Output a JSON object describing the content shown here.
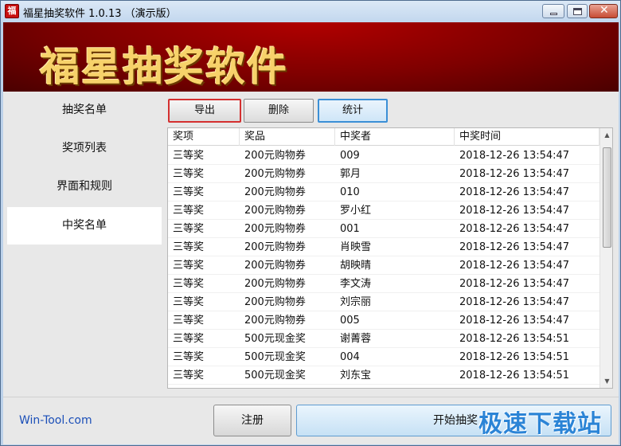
{
  "window": {
    "title": "福星抽奖软件 1.0.13 （演示版）",
    "app_icon_char": "福"
  },
  "banner": {
    "title": "福星抽奖软件"
  },
  "sidebar": {
    "items": [
      {
        "label": "抽奖名单",
        "active": false
      },
      {
        "label": "奖项列表",
        "active": false
      },
      {
        "label": "界面和规则",
        "active": false
      },
      {
        "label": "中奖名单",
        "active": true
      }
    ]
  },
  "toolbar": {
    "export_label": "导出",
    "delete_label": "删除",
    "stats_label": "统计"
  },
  "table": {
    "columns": [
      "奖项",
      "奖品",
      "中奖者",
      "中奖时间"
    ],
    "rows": [
      [
        "三等奖",
        "200元购物券",
        "009",
        "2018-12-26 13:54:47"
      ],
      [
        "三等奖",
        "200元购物券",
        "郭月",
        "2018-12-26 13:54:47"
      ],
      [
        "三等奖",
        "200元购物券",
        "010",
        "2018-12-26 13:54:47"
      ],
      [
        "三等奖",
        "200元购物券",
        "罗小红",
        "2018-12-26 13:54:47"
      ],
      [
        "三等奖",
        "200元购物券",
        "001",
        "2018-12-26 13:54:47"
      ],
      [
        "三等奖",
        "200元购物券",
        "肖映雪",
        "2018-12-26 13:54:47"
      ],
      [
        "三等奖",
        "200元购物券",
        "胡映晴",
        "2018-12-26 13:54:47"
      ],
      [
        "三等奖",
        "200元购物券",
        "李文涛",
        "2018-12-26 13:54:47"
      ],
      [
        "三等奖",
        "200元购物券",
        "刘宗丽",
        "2018-12-26 13:54:47"
      ],
      [
        "三等奖",
        "200元购物券",
        "005",
        "2018-12-26 13:54:47"
      ],
      [
        "三等奖",
        "500元现金奖",
        "谢菁蓉",
        "2018-12-26 13:54:51"
      ],
      [
        "三等奖",
        "500元现金奖",
        "004",
        "2018-12-26 13:54:51"
      ],
      [
        "三等奖",
        "500元现金奖",
        "刘东宝",
        "2018-12-26 13:54:51"
      ]
    ]
  },
  "footer": {
    "link_text": "Win-Tool.com",
    "register_label": "注册",
    "start_label": "开始抽奖"
  },
  "watermark": {
    "text": "极速下载站"
  },
  "colors": {
    "banner_red": "#7e0000",
    "banner_text": "#f7d26a",
    "link_blue": "#1b4fb8",
    "watermark_blue": "#2b84d6",
    "export_highlight": "#d43030"
  },
  "icons": {
    "minimize": "minimize-icon",
    "maximize": "maximize-icon",
    "close": "close-icon",
    "scroll_up": "scroll-up-icon",
    "scroll_down": "scroll-down-icon"
  }
}
